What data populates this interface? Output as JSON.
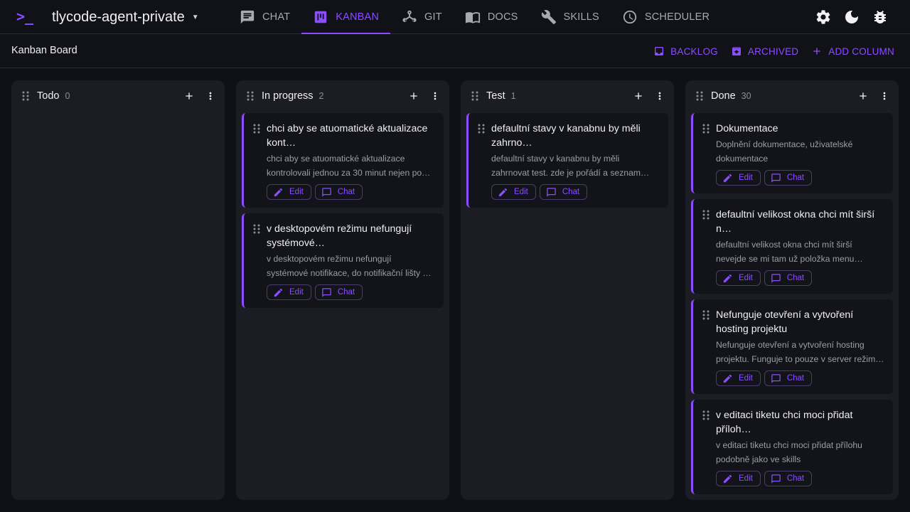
{
  "app": {
    "logo": ">_",
    "project": "tlycode-agent-private"
  },
  "nav": {
    "tabs": [
      {
        "label": "CHAT",
        "icon": "chat-icon",
        "active": false
      },
      {
        "label": "KANBAN",
        "icon": "kanban-icon",
        "active": true
      },
      {
        "label": "GIT",
        "icon": "git-icon",
        "active": false
      },
      {
        "label": "DOCS",
        "icon": "docs-icon",
        "active": false
      },
      {
        "label": "SKILLS",
        "icon": "wrench-icon",
        "active": false
      },
      {
        "label": "SCHEDULER",
        "icon": "clock-icon",
        "active": false
      }
    ]
  },
  "toolbar": {
    "title": "Kanban Board",
    "backlog": "BACKLOG",
    "archived": "ARCHIVED",
    "add_column": "ADD COLUMN"
  },
  "card_actions": {
    "edit": "Edit",
    "chat": "Chat"
  },
  "colors": {
    "accent": "#8b4dff",
    "background": "#101116",
    "column": "#1c1d24",
    "card": "#131419"
  },
  "columns": [
    {
      "title": "Todo",
      "count": "0",
      "cards": []
    },
    {
      "title": "In progress",
      "count": "2",
      "cards": [
        {
          "title": "chci aby se atuomatické aktualizace kont…",
          "desc": "chci aby se atuomatické aktualizace kontrolovali jednou za 30 minut nejen po…"
        },
        {
          "title": "v desktopovém režimu nefungují systémové…",
          "desc": "v desktopovém režimu nefungují systémové notifikace, do notifikační lišty se nic nepos…"
        }
      ]
    },
    {
      "title": "Test",
      "count": "1",
      "cards": [
        {
          "title": "defaultní stavy v kanabnu by měli zahrno…",
          "desc": "defaultní stavy v kanabnu by měli zahrnovat test. zde je pořádí a seznam stavu todo, i…"
        }
      ]
    },
    {
      "title": "Done",
      "count": "30",
      "cards": [
        {
          "title": "Dokumentace",
          "desc": "Doplnění dokumentace, uživatelské dokumentace"
        },
        {
          "title": "defaultní velikost okna chci mít širší n…",
          "desc": "defaultní velikost okna chci mít širší nevejde se mi tam už položka menu hostingu, chci…"
        },
        {
          "title": "Nefunguje otevření a vytvoření hosting projektu",
          "desc": "Nefunguje otevření a vytvoření hosting projektu. Funguje to pouze v server režim…"
        },
        {
          "title": "v editaci tiketu chci moci přidat příloh…",
          "desc": "v editaci tiketu chci moci přidat přílohu podobně jako ve skills"
        }
      ]
    }
  ]
}
